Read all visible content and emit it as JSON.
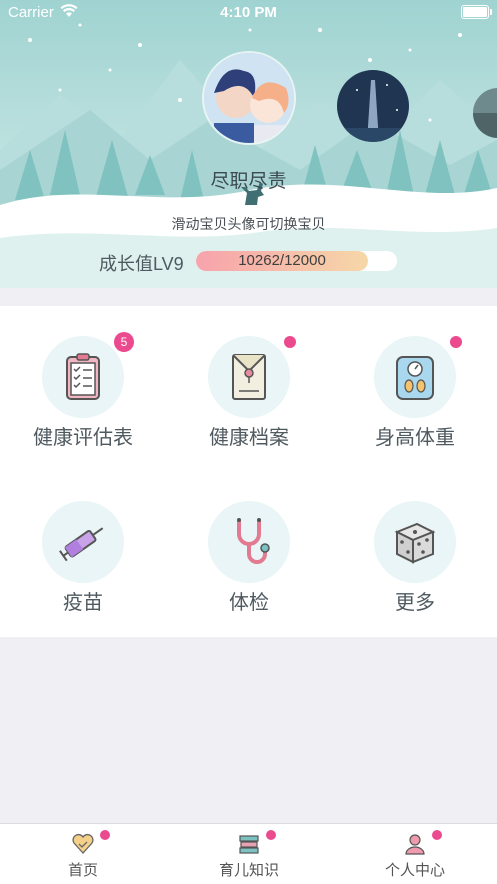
{
  "status_bar": {
    "carrier": "Carrier",
    "time": "4:10 PM"
  },
  "hero": {
    "baby_name": "尽职尽责",
    "swipe_hint": "滑动宝贝头像可切换宝贝",
    "growth": {
      "label": "成长值LV9",
      "value_text": "10262/12000",
      "current": 10262,
      "max": 12000
    }
  },
  "menu": [
    {
      "label": "健康评估表",
      "icon": "clipboard-checklist-icon",
      "badge": "5"
    },
    {
      "label": "健康档案",
      "icon": "envelope-file-icon",
      "badge_dot": true
    },
    {
      "label": "身高体重",
      "icon": "scale-icon",
      "badge_dot": true
    },
    {
      "label": "疫苗",
      "icon": "syringe-icon"
    },
    {
      "label": "体检",
      "icon": "stethoscope-icon"
    },
    {
      "label": "更多",
      "icon": "dice-icon"
    }
  ],
  "tabbar": [
    {
      "label": "首页",
      "icon": "heart-home-icon"
    },
    {
      "label": "育儿知识",
      "icon": "books-icon"
    },
    {
      "label": "个人中心",
      "icon": "person-icon"
    }
  ],
  "colors": {
    "accent": "#ec4a8e",
    "icon_bg": "#e9f5f6",
    "hero_sky": "#bfe3e0"
  }
}
